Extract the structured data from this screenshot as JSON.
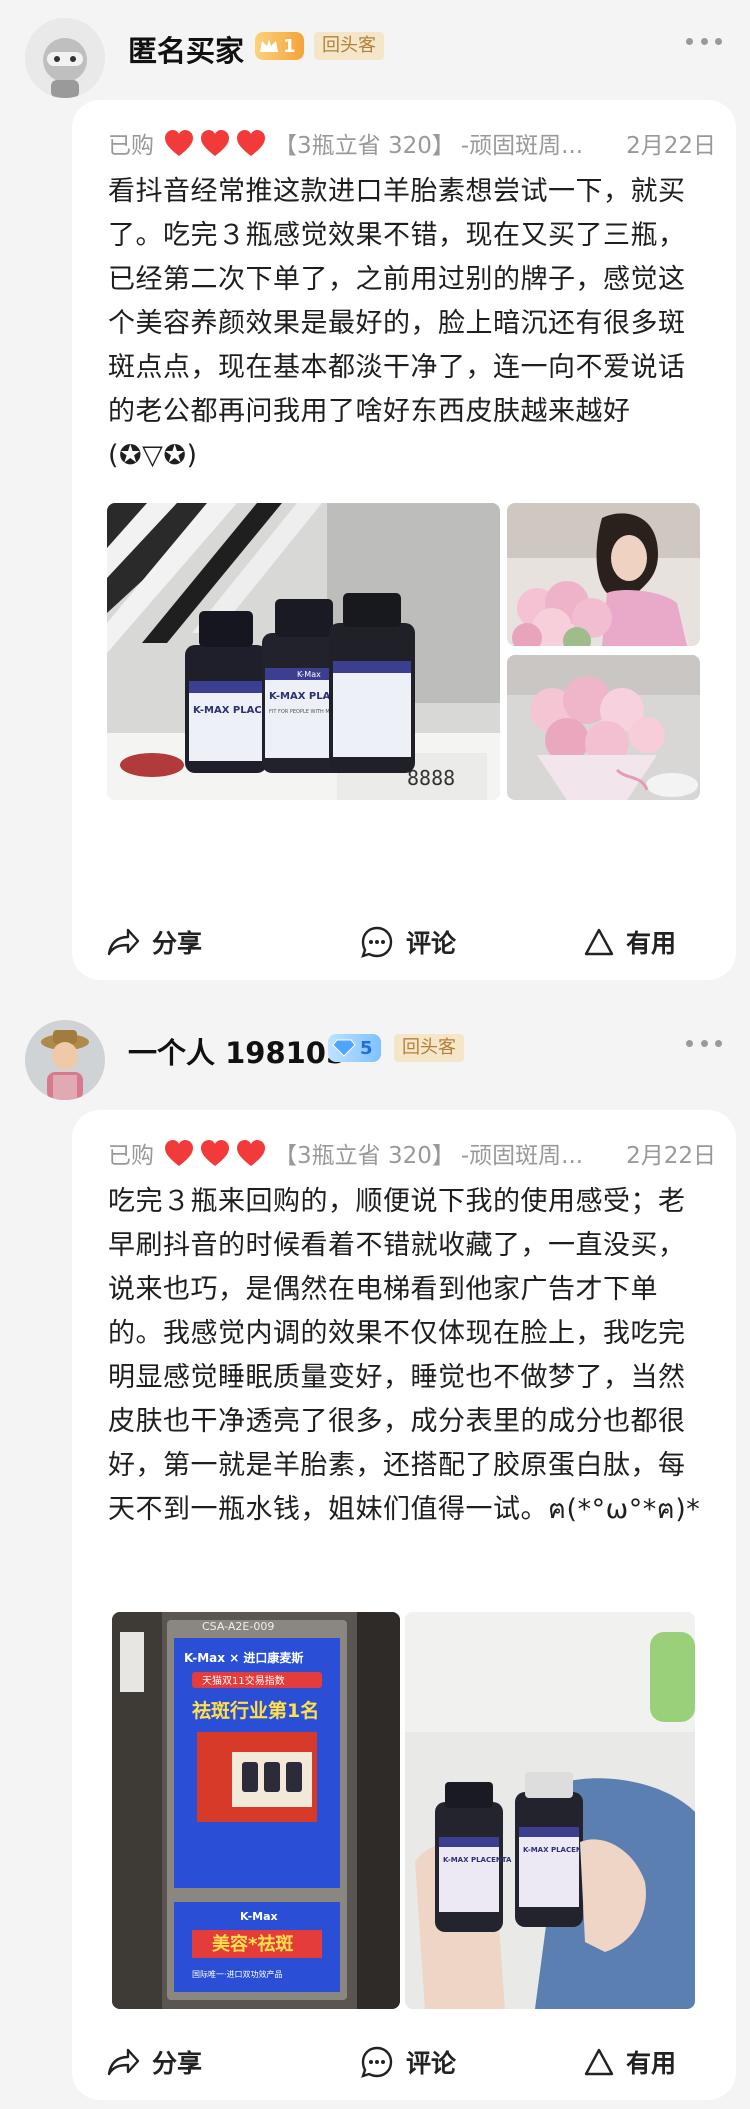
{
  "reviews": [
    {
      "user": {
        "name": "匿名买家",
        "level": "1",
        "repeat_badge": "回头客"
      },
      "meta": {
        "purchased": "已购",
        "spec": "【3瓶立省 320】",
        "product": "-顽固斑周...",
        "date": "2月22日"
      },
      "text": "看抖音经常推这款进口羊胎素想尝试一下，就买了。吃完３瓶感觉效果不错，现在又买了三瓶，已经第二次下单了，之前用过别的牌子，感觉这个美容养颜效果是最好的，脸上暗沉还有很多斑斑点点，现在基本都淡干净了，连一向不爱说话的老公都再问我用了啥好东西皮肤越来越好 (✪▽✪)",
      "photos": {
        "bottle_brand": "K-Max",
        "bottle_label": "K-MAX PLACENTA",
        "bottle_sub": "FIT FOR PEOPLE WITH MELASMA",
        "display_digits": "8888"
      },
      "actions": {
        "share": "分享",
        "comment": "评论",
        "useful": "有用"
      }
    },
    {
      "user": {
        "name": "一个人 198105",
        "level": "5",
        "repeat_badge": "回头客"
      },
      "meta": {
        "purchased": "已购",
        "spec": "【3瓶立省 320】",
        "product": "-顽固斑周...",
        "date": "2月22日"
      },
      "text": "吃完３瓶来回购的，顺便说下我的使用感受；老早刷抖音的时候看着不错就收藏了，一直没买，说来也巧，是偶然在电梯看到他家广告才下单的。我感觉内调的效果不仅体现在脸上，我吃完明显感觉睡眠质量变好，睡觉也不做梦了，当然皮肤也干净透亮了很多，成分表里的成分也都很好，第一就是羊胎素，还搭配了胶原蛋白肽，每天不到一瓶水钱，姐妹们值得一试。ฅ(*°ω°*ฅ)*",
      "photos": {
        "ad_code": "CSA-A2E-009",
        "ad_brand": "K-Max × 进口康麦斯",
        "ad_event": "天猫双11交易指数",
        "ad_headline": "祛斑行业第1名",
        "ad_logo": "K-Max",
        "ad_slogan": "美容*祛斑",
        "ad_foot": "国际唯一·进口双功效产品",
        "bottle_label": "K-MAX PLACENTA"
      },
      "actions": {
        "share": "分享",
        "comment": "评论",
        "useful": "有用"
      }
    }
  ],
  "colors": {
    "heart": "#f23a3a",
    "gold_badge": "#f5a33a",
    "blue_badge": "#7fc2ff",
    "repeat_badge_text": "#b0813c"
  }
}
